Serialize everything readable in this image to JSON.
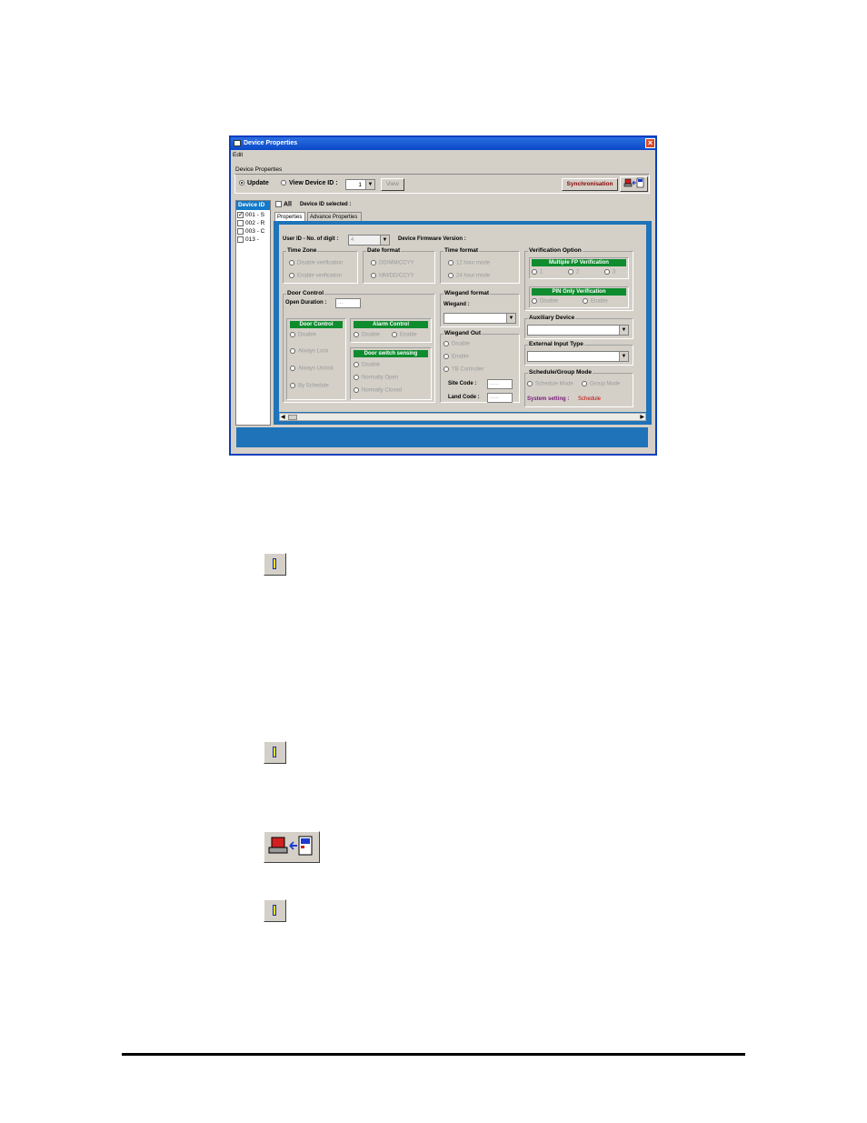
{
  "window": {
    "title": "Device Properties",
    "close_glyph": "×"
  },
  "menu": {
    "edit": "Edit"
  },
  "device_properties_label": "Device Properties",
  "top": {
    "update": "Update",
    "view_device_id": "View Device ID :",
    "device_id_value": "1",
    "view_button": "View",
    "sync_button": "Synchronisation"
  },
  "device_list": {
    "header": "Device ID",
    "all": "All",
    "selected_label": "Device ID selected :",
    "items": [
      "001 - S",
      "002 - R",
      "003 - C",
      "013 -"
    ]
  },
  "tabs": [
    "Properties",
    "Advance Properties"
  ],
  "panel": {
    "user_id_label": "User ID - No. of digit :",
    "user_id_value": "4",
    "firmware_label": "Device Firmware Version :",
    "time_zone": {
      "title": "Time Zone",
      "opt1": "Disable verification",
      "opt2": "Enable verification"
    },
    "date_format": {
      "title": "Date format",
      "opt1": "DD/MM/CCYY",
      "opt2": "MM/DD/CCYY"
    },
    "time_format": {
      "title": "Time format",
      "opt1": "12 hour mode",
      "opt2": "24 hour mode"
    },
    "verification": {
      "title": "Verification Option",
      "multi_fp": "Multiple FP Verification",
      "fp_opts": [
        "1",
        "2",
        "3"
      ],
      "pin_only": "PIN Only Verification",
      "pin_disable": "Disable",
      "pin_enable": "Enable"
    },
    "door_control": {
      "title": "Door Control",
      "open_duration": "Open Duration :",
      "open_duration_value": "...",
      "sub_title": "Door Control",
      "opts": [
        "Disable",
        "Always Lock",
        "Always Unlock",
        "By Schedule"
      ]
    },
    "alarm_control": {
      "title": "Alarm Control",
      "disable": "Disable",
      "enable": "Enable"
    },
    "door_switch": {
      "title": "Door switch sensing",
      "opts": [
        "Disable",
        "Normally Open",
        "Normally Closed"
      ]
    },
    "wiegand_format": {
      "title": "Wiegand format",
      "label": "Wiegand :"
    },
    "wiegand_out": {
      "title": "Wiegand Out",
      "opts": [
        "Disable",
        "Enable",
        "TB Controller"
      ],
      "site_code": "Site Code :",
      "land_code": "Land Code :",
      "site_value": "......",
      "land_value": "......"
    },
    "auxiliary_device": {
      "title": "Auxiliary Device"
    },
    "external_input": {
      "title": "External Input Type"
    },
    "schedule_group": {
      "title": "Schedule/Group Mode",
      "schedule_mode": "Schedule Mode",
      "group_mode": "Group Mode",
      "system_setting_label": "System setting :",
      "system_setting_value": "Schedule"
    }
  },
  "colors": {
    "title_bar": "#0a48c8",
    "panel_blue": "#1f73b8",
    "green_header": "#0e8c2e",
    "sync_text": "#8b0000",
    "schedule_text": "#c00000"
  }
}
